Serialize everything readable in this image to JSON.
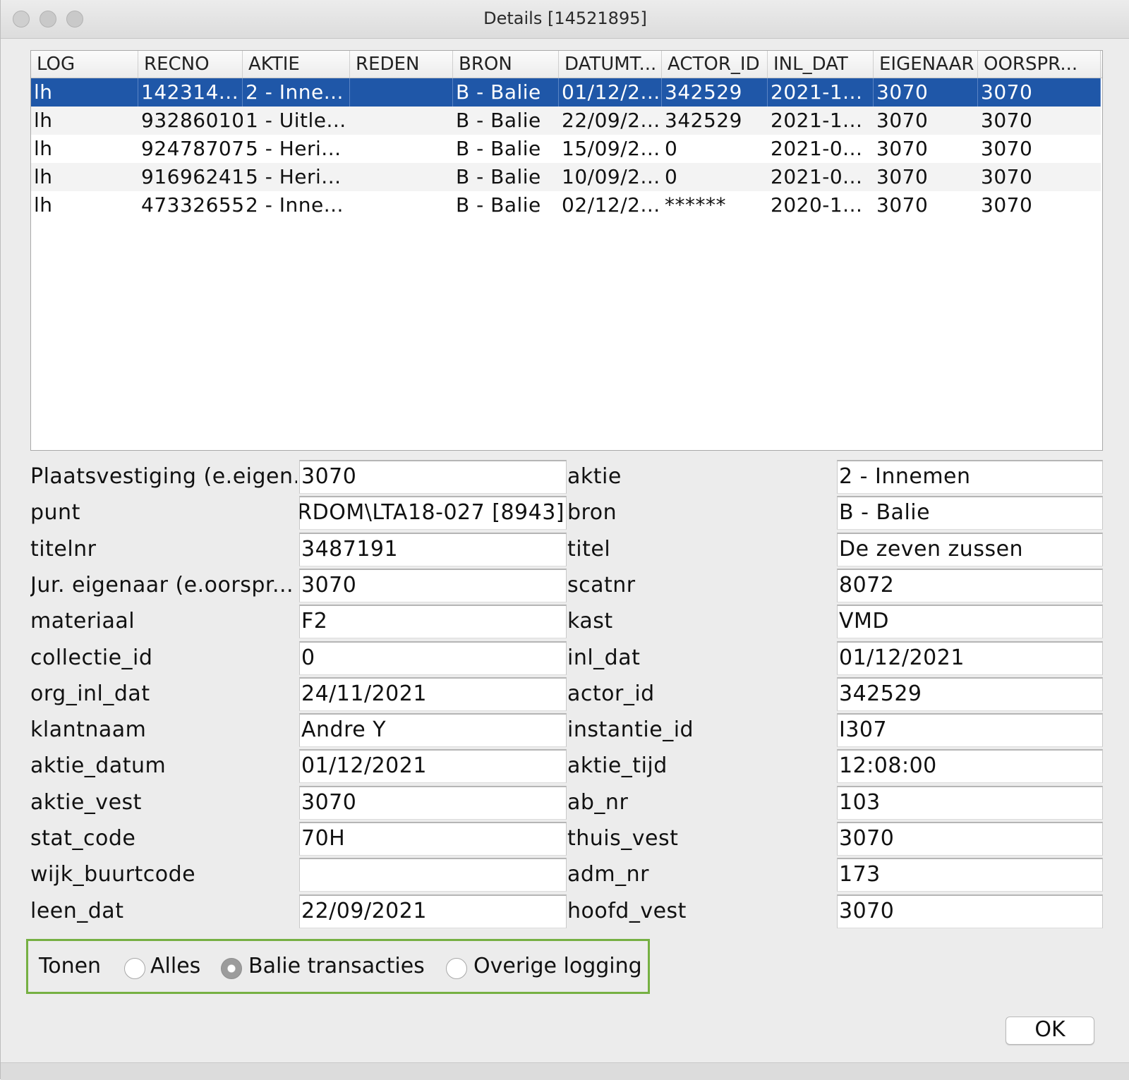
{
  "window": {
    "title": "Details [14521895]"
  },
  "table": {
    "columns": [
      "LOG",
      "RECNO",
      "AKTIE",
      "REDEN",
      "BRON",
      "DATUMT...",
      "ACTOR_ID",
      "INL_DAT",
      "EIGENAAR",
      "OORSPR..."
    ],
    "rows": [
      [
        "lh",
        "142314...",
        "2 - Inne...",
        "",
        "B - Balie",
        "01/12/2...",
        "342529",
        "2021-1...",
        "3070",
        "3070"
      ],
      [
        "lh",
        "93286010",
        "1 - Uitle...",
        "",
        "B - Balie",
        "22/09/2...",
        "342529",
        "2021-1...",
        "3070",
        "3070"
      ],
      [
        "lh",
        "92478707",
        "5 - Heri...",
        "",
        "B - Balie",
        "15/09/2...",
        "0",
        "2021-0...",
        "3070",
        "3070"
      ],
      [
        "lh",
        "91696241",
        "5 - Heri...",
        "",
        "B - Balie",
        "10/09/2...",
        "0",
        "2021-0...",
        "3070",
        "3070"
      ],
      [
        "lh",
        "47332655",
        "2 - Inne...",
        "",
        "B - Balie",
        "02/12/2...",
        "******",
        "2020-1...",
        "3070",
        "3070"
      ]
    ],
    "selected_row": 0,
    "selected_color": "#1f57a8"
  },
  "fields_left": [
    {
      "label": "Plaatsvestiging (e.eigen...",
      "value": "3070"
    },
    {
      "label": "punt",
      "value": "RDOM\\LTA18-027 [8943]"
    },
    {
      "label": "titelnr",
      "value": "3487191"
    },
    {
      "label": "Jur. eigenaar (e.oorspr...",
      "value": "3070"
    },
    {
      "label": "materiaal",
      "value": "F2"
    },
    {
      "label": "collectie_id",
      "value": "0"
    },
    {
      "label": "org_inl_dat",
      "value": "24/11/2021"
    },
    {
      "label": "klantnaam",
      "value": "Andre Y"
    },
    {
      "label": "aktie_datum",
      "value": "01/12/2021"
    },
    {
      "label": "aktie_vest",
      "value": "3070"
    },
    {
      "label": "stat_code",
      "value": "70H"
    },
    {
      "label": "wijk_buurtcode",
      "value": ""
    },
    {
      "label": "leen_dat",
      "value": "22/09/2021"
    }
  ],
  "fields_right": [
    {
      "label": "aktie",
      "value": "2 - Innemen"
    },
    {
      "label": "bron",
      "value": "B - Balie"
    },
    {
      "label": "titel",
      "value": "De zeven zussen"
    },
    {
      "label": "scatnr",
      "value": "8072"
    },
    {
      "label": "kast",
      "value": "VMD"
    },
    {
      "label": "inl_dat",
      "value": "01/12/2021"
    },
    {
      "label": "actor_id",
      "value": "342529"
    },
    {
      "label": "instantie_id",
      "value": "I307"
    },
    {
      "label": "aktie_tijd",
      "value": "12:08:00"
    },
    {
      "label": "ab_nr",
      "value": "103"
    },
    {
      "label": "thuis_vest",
      "value": "3070"
    },
    {
      "label": "adm_nr",
      "value": "173"
    },
    {
      "label": "hoofd_vest",
      "value": "3070"
    }
  ],
  "tonen": {
    "label": "Tonen",
    "options": [
      "Alles",
      "Balie transacties",
      "Overige logging"
    ],
    "selected": 1,
    "highlight_color": "#76b043"
  },
  "ok_label": "OK"
}
